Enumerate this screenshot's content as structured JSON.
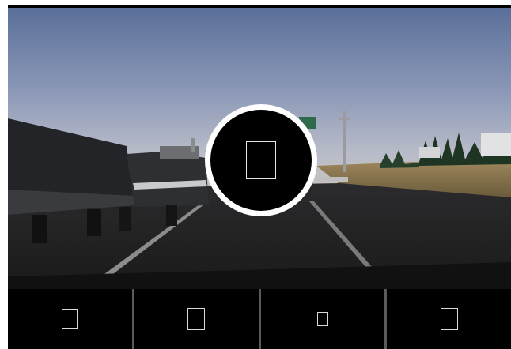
{
  "player": {
    "play_icon": "missing-glyph-icon",
    "controls": [
      {
        "icon": "missing-glyph-icon"
      },
      {
        "icon": "missing-glyph-icon"
      },
      {
        "icon": "missing-glyph-icon"
      },
      {
        "icon": "missing-glyph-icon"
      }
    ]
  },
  "colors": {
    "background": "#000000",
    "play_ring": "#ffffff",
    "separator": "#5a5a5a"
  }
}
